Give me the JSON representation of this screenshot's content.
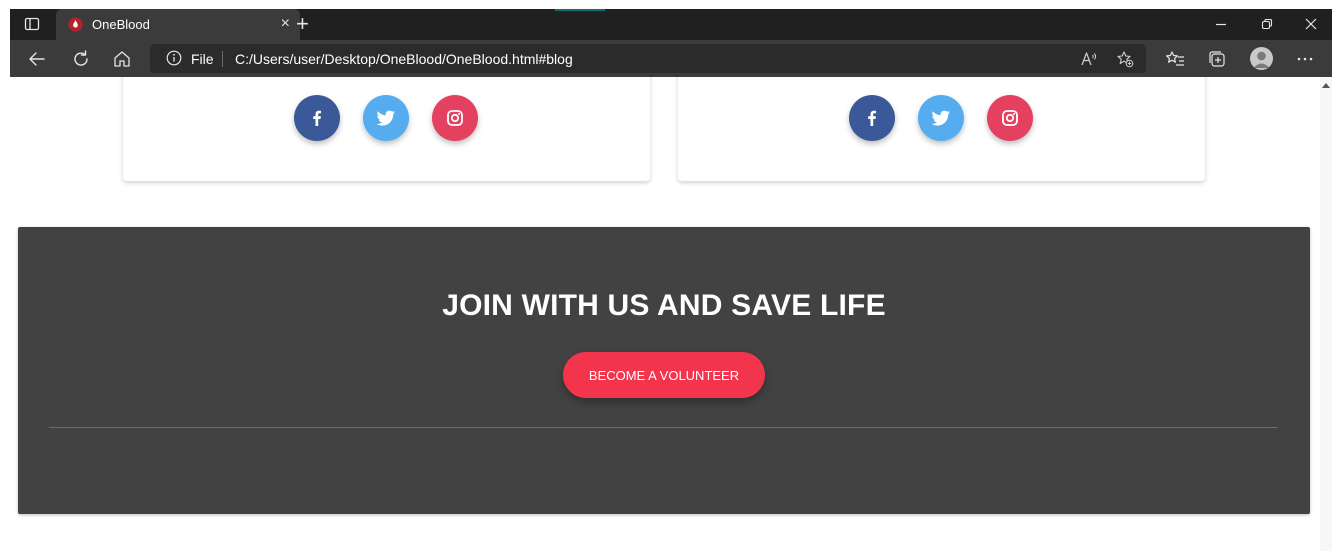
{
  "browser": {
    "tab_title": "OneBlood",
    "tab_close": "×",
    "new_tab": "+",
    "address_scheme": "File",
    "address_url": "C:/Users/user/Desktop/OneBlood/OneBlood.html#blog",
    "menu": "···",
    "colors": {
      "tabstrip": "#202020",
      "toolbar": "#3b3b3b",
      "address": "#2b2b2b"
    }
  },
  "cards": [
    {
      "social": [
        {
          "icon": "facebook-icon",
          "color": "#3b5998"
        },
        {
          "icon": "twitter-icon",
          "color": "#55acee"
        },
        {
          "icon": "instagram-icon",
          "color": "#e4405f"
        }
      ]
    },
    {
      "social": [
        {
          "icon": "facebook-icon",
          "color": "#3b5998"
        },
        {
          "icon": "twitter-icon",
          "color": "#55acee"
        },
        {
          "icon": "instagram-icon",
          "color": "#e4405f"
        }
      ]
    }
  ],
  "join": {
    "title": "JOIN WITH US AND SAVE LIFE",
    "button_label": "BECOME A VOLUNTEER",
    "colors": {
      "background": "#424242",
      "button": "#f2344c"
    }
  }
}
